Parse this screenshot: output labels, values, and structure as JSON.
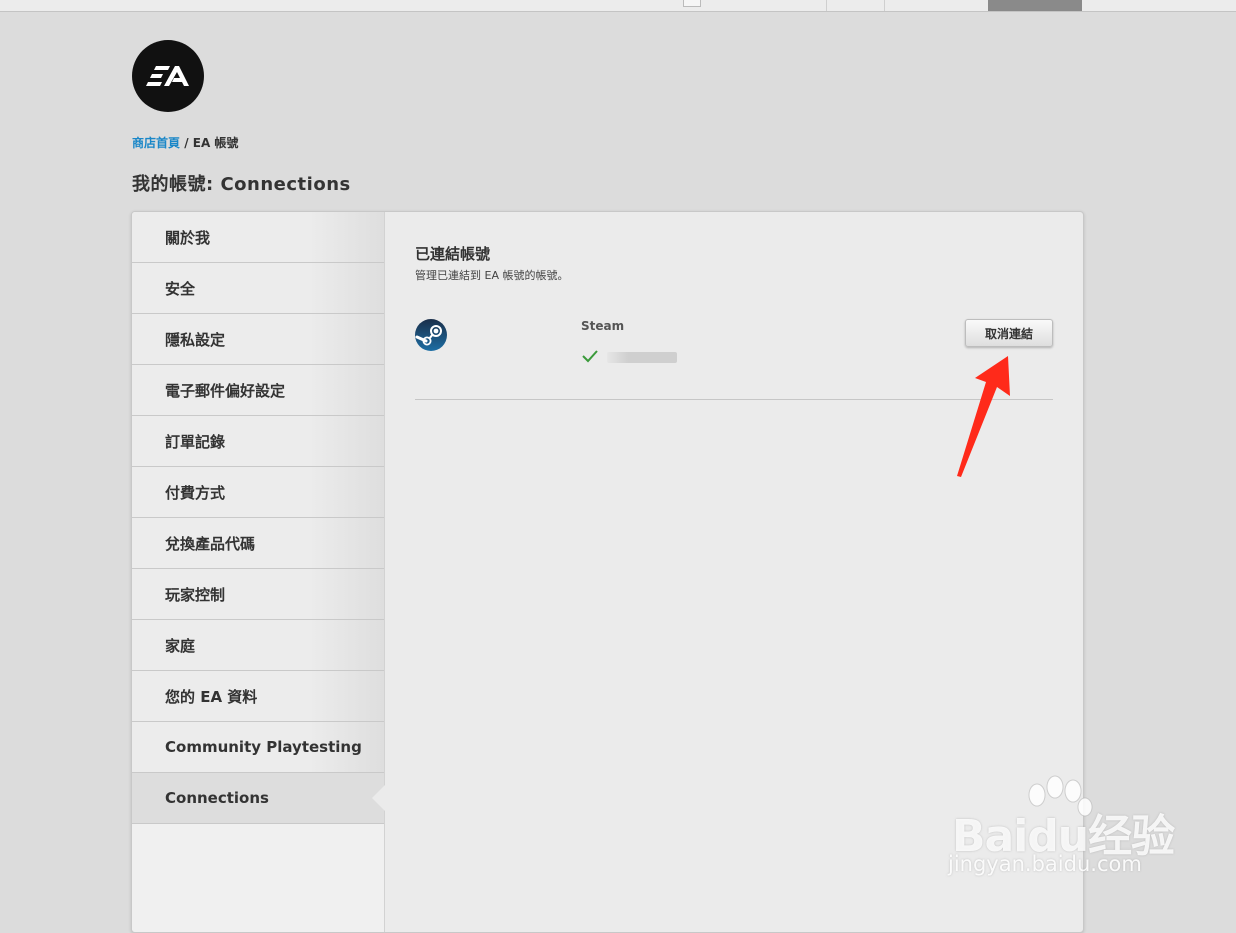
{
  "brand": {
    "logo_text": "EA",
    "accent_link_color": "#1a87c8"
  },
  "breadcrumb": {
    "home": "商店首頁",
    "separator": " / ",
    "current": "EA 帳號"
  },
  "page_title": "我的帳號: Connections",
  "sidebar": {
    "items": [
      {
        "label": "關於我"
      },
      {
        "label": "安全"
      },
      {
        "label": "隱私設定"
      },
      {
        "label": "電子郵件偏好設定"
      },
      {
        "label": "訂單記錄"
      },
      {
        "label": "付費方式"
      },
      {
        "label": "兌換產品代碼"
      },
      {
        "label": "玩家控制"
      },
      {
        "label": "家庭"
      },
      {
        "label": "您的 EA 資料"
      },
      {
        "label": "Community Playtesting"
      },
      {
        "label": "Connections"
      }
    ],
    "active_index": 11
  },
  "connections": {
    "title": "已連結帳號",
    "subtitle": "管理已連結到 EA 帳號的帳號。",
    "items": [
      {
        "platform": "Steam",
        "icon": "steam-icon",
        "status_icon": "check-icon",
        "status_color": "#3a9a3a",
        "unlink_label": "取消連結"
      }
    ]
  },
  "annotation": {
    "arrow_color": "#ff2a1a"
  },
  "watermark": {
    "logo_text": "Baidu经验",
    "url": "jingyan.baidu.com"
  }
}
